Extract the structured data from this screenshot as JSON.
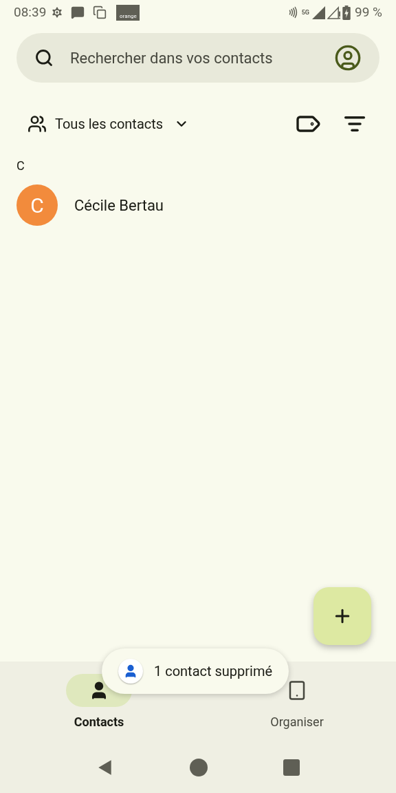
{
  "status_bar": {
    "time": "08:39",
    "carrier_logo": "orange",
    "network": "5G",
    "battery": "99 %"
  },
  "search": {
    "placeholder": "Rechercher dans vos contacts"
  },
  "filter": {
    "label": "Tous les contacts"
  },
  "sections": [
    {
      "letter": "C",
      "contacts": [
        {
          "initial": "C",
          "name": "Cécile Bertau",
          "color": "#f28b3c"
        }
      ]
    }
  ],
  "snackbar": {
    "text": "1 contact supprimé"
  },
  "nav": [
    {
      "label": "Contacts",
      "kind": "person",
      "selected": true
    },
    {
      "label": "Organiser",
      "kind": "tablet",
      "selected": false
    }
  ]
}
